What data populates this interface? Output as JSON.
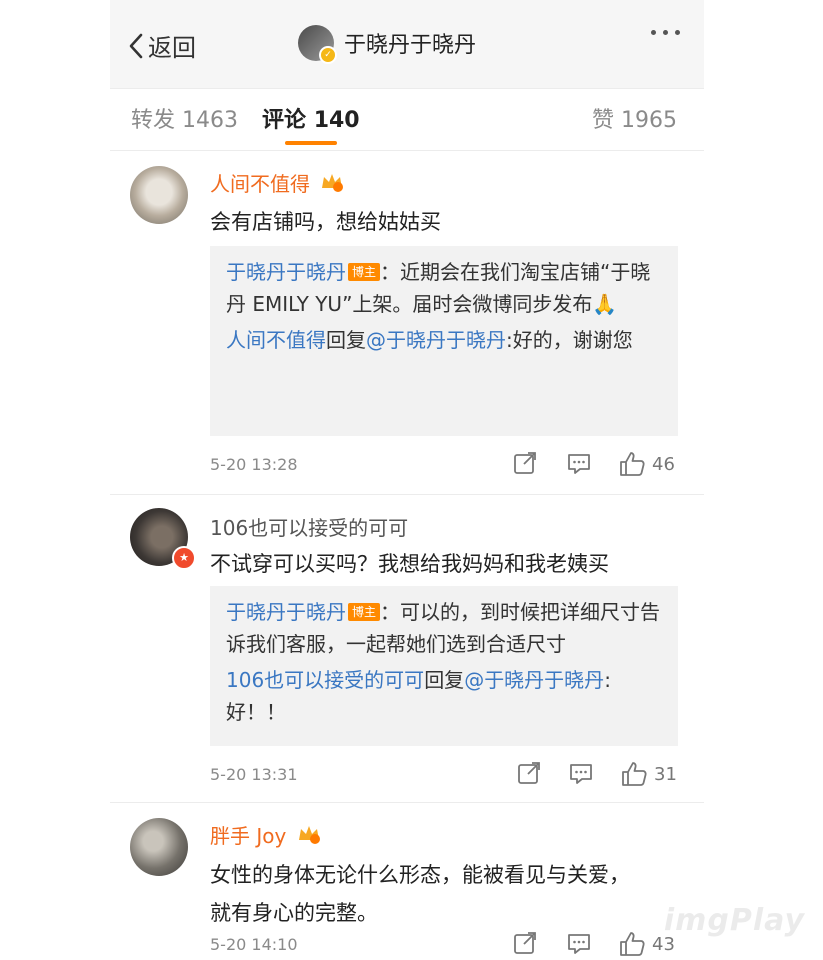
{
  "nav": {
    "back_label": "返回",
    "title": "于晓丹于晓丹"
  },
  "tabs": [
    {
      "label": "转发",
      "count": "1463"
    },
    {
      "label": "评论",
      "count": "140"
    },
    {
      "label": "赞",
      "count": "1965"
    }
  ],
  "comments": [
    {
      "user": "人间不值得",
      "text": "会有店铺吗，想给姑姑买",
      "reply1_author": "于晓丹于晓丹",
      "host_badge": "博主",
      "reply1_text": "：近期会在我们淘宝店铺“于晓丹 EMILY YU”上架。届时会微博同步发布🙏",
      "reply2_author": "人间不值得",
      "reply2_mid": "回复",
      "reply2_mention": "@于晓丹于晓丹",
      "reply2_text": ":好的，谢谢您",
      "time": "5-20 13:28",
      "likes": "46"
    },
    {
      "user": "106也可以接受的可可",
      "text": "不试穿可以买吗？我想给我妈妈和我老姨买",
      "reply1_author": "于晓丹于晓丹",
      "host_badge": "博主",
      "reply1_text": "：可以的，到时候把详细尺寸告诉我们客服，一起帮她们选到合适尺寸",
      "reply2_author": "106也可以接受的可可",
      "reply2_mid": "回复",
      "reply2_mention": "@于晓丹于晓丹",
      "reply2_text": ":好！！",
      "time": "5-20 13:31",
      "likes": "31"
    },
    {
      "user": "胖手 Joy",
      "text": "女性的身体无论什么形态，能被看见与关爱，就有身心的完整。",
      "time": "5-20 14:10",
      "likes": "43"
    }
  ],
  "watermark": "imgPlay",
  "colors": {
    "accent": "#ff8200",
    "link": "#3a77c2",
    "username_orange": "#f06b1f"
  }
}
